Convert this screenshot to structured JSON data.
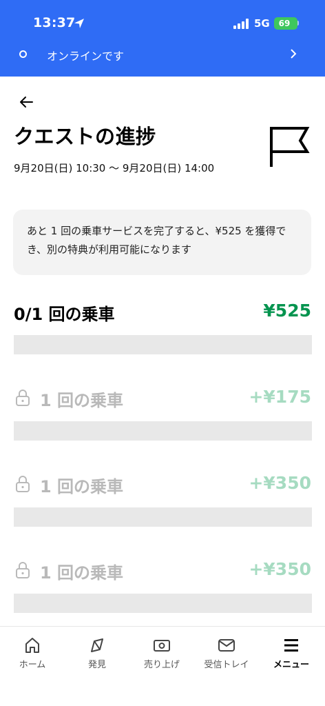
{
  "status_bar": {
    "time": "13:37",
    "network": "5G",
    "battery": "69"
  },
  "online_banner": {
    "text": "オンラインです"
  },
  "page": {
    "title": "クエストの進捗",
    "date_range": "9月20日(日) 10:30 〜 9月20日(日) 14:00",
    "info": "あと 1 回の乗車サービスを完了すると、¥525 を獲得でき、別の特典が利用可能になります"
  },
  "progress": {
    "label": "0/1 回の乗車",
    "amount": "¥525",
    "fraction": 0
  },
  "locked_tiers": [
    {
      "label": "1 回の乗車",
      "amount": "+¥175"
    },
    {
      "label": "1 回の乗車",
      "amount": "+¥350"
    },
    {
      "label": "1 回の乗車",
      "amount": "+¥350"
    }
  ],
  "nav": [
    {
      "label": "ホーム",
      "icon": "home-icon"
    },
    {
      "label": "発見",
      "icon": "compass-icon"
    },
    {
      "label": "売り上げ",
      "icon": "earnings-icon"
    },
    {
      "label": "受信トレイ",
      "icon": "mail-icon"
    },
    {
      "label": "メニュー",
      "icon": "menu-icon"
    }
  ],
  "colors": {
    "topbar": "#2f6cf5",
    "accent_green": "#05944f",
    "locked_green": "#a6dbc1",
    "locked_text": "#b9b9b9"
  }
}
